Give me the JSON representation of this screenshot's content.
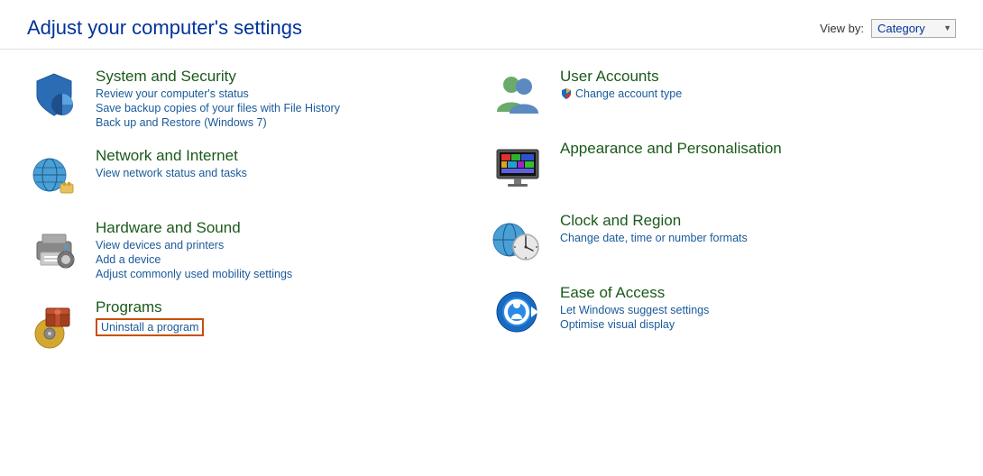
{
  "header": {
    "title": "Adjust your computer's settings",
    "view_by_label": "View by:",
    "view_by_value": "Category"
  },
  "left_categories": [
    {
      "id": "system-security",
      "title": "System and Security",
      "links": [
        "Review your computer's status",
        "Save backup copies of your files with File History",
        "Back up and Restore (Windows 7)"
      ]
    },
    {
      "id": "network-internet",
      "title": "Network and Internet",
      "links": [
        "View network status and tasks"
      ]
    },
    {
      "id": "hardware-sound",
      "title": "Hardware and Sound",
      "links": [
        "View devices and printers",
        "Add a device",
        "Adjust commonly used mobility settings"
      ]
    },
    {
      "id": "programs",
      "title": "Programs",
      "links": [
        "Uninstall a program"
      ],
      "highlighted_link": "Uninstall a program"
    }
  ],
  "right_categories": [
    {
      "id": "user-accounts",
      "title": "User Accounts",
      "links": [
        "Change account type"
      ],
      "uac_link": "Change account type"
    },
    {
      "id": "appearance",
      "title": "Appearance and Personalisation",
      "links": []
    },
    {
      "id": "clock-region",
      "title": "Clock and Region",
      "links": [
        "Change date, time or number formats"
      ]
    },
    {
      "id": "ease-access",
      "title": "Ease of Access",
      "links": [
        "Let Windows suggest settings",
        "Optimise visual display"
      ]
    }
  ]
}
